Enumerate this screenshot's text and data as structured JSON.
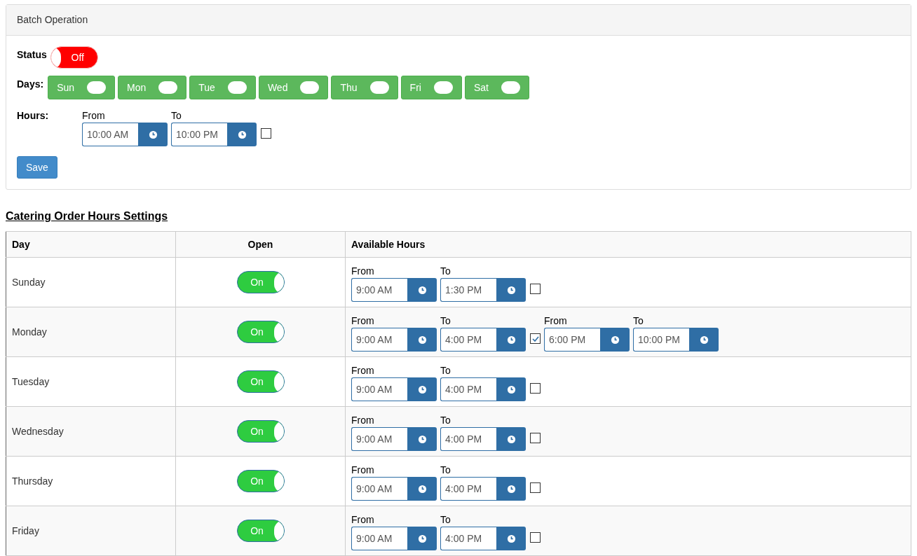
{
  "batch": {
    "title": "Batch Operation",
    "status_label": "Status",
    "status": {
      "on": false,
      "text": "Off"
    },
    "days_label": "Days:",
    "days": [
      {
        "label": "Sun"
      },
      {
        "label": "Mon"
      },
      {
        "label": "Tue"
      },
      {
        "label": "Wed"
      },
      {
        "label": "Thu"
      },
      {
        "label": "Fri"
      },
      {
        "label": "Sat"
      }
    ],
    "hours_label": "Hours:",
    "from_label": "From",
    "to_label": "To",
    "from": "10:00 AM",
    "to": "10:00 PM",
    "split_checked": false,
    "save": "Save"
  },
  "settings": {
    "title": "Catering Order Hours Settings",
    "columns": [
      "Day",
      "Open",
      "Available Hours"
    ],
    "rows": [
      {
        "day": "Sunday",
        "open": true,
        "open_text": "On",
        "split_checked": false,
        "ranges": [
          {
            "from_label": "From",
            "from": "9:00 AM",
            "to_label": "To",
            "to": "1:30 PM"
          }
        ]
      },
      {
        "day": "Monday",
        "open": true,
        "open_text": "On",
        "split_checked": true,
        "ranges": [
          {
            "from_label": "From",
            "from": "9:00 AM",
            "to_label": "To",
            "to": "4:00 PM"
          },
          {
            "from_label": "From",
            "from": "6:00 PM",
            "to_label": "To",
            "to": "10:00 PM"
          }
        ]
      },
      {
        "day": "Tuesday",
        "open": true,
        "open_text": "On",
        "split_checked": false,
        "ranges": [
          {
            "from_label": "From",
            "from": "9:00 AM",
            "to_label": "To",
            "to": "4:00 PM"
          }
        ]
      },
      {
        "day": "Wednesday",
        "open": true,
        "open_text": "On",
        "split_checked": false,
        "ranges": [
          {
            "from_label": "From",
            "from": "9:00 AM",
            "to_label": "To",
            "to": "4:00 PM"
          }
        ]
      },
      {
        "day": "Thursday",
        "open": true,
        "open_text": "On",
        "split_checked": false,
        "ranges": [
          {
            "from_label": "From",
            "from": "9:00 AM",
            "to_label": "To",
            "to": "4:00 PM"
          }
        ]
      },
      {
        "day": "Friday",
        "open": true,
        "open_text": "On",
        "split_checked": false,
        "ranges": [
          {
            "from_label": "From",
            "from": "9:00 AM",
            "to_label": "To",
            "to": "4:00 PM"
          }
        ]
      }
    ]
  }
}
